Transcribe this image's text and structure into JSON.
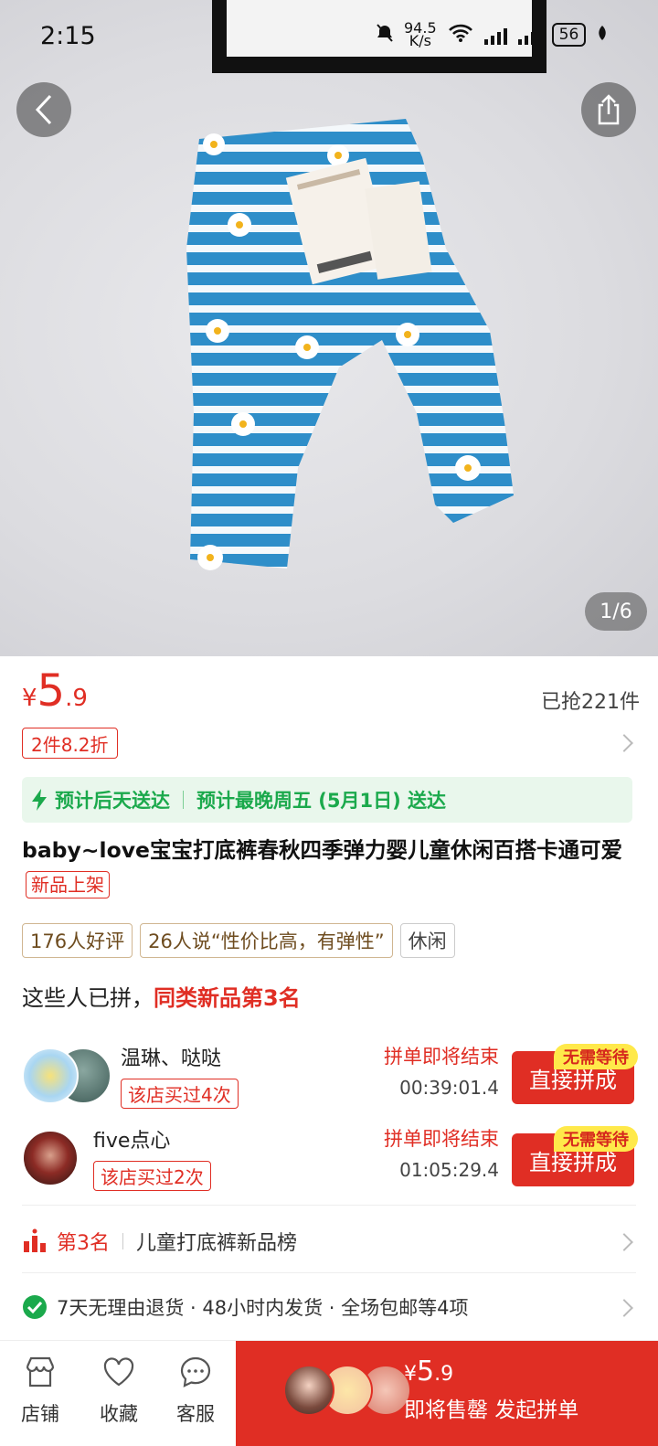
{
  "status_bar": {
    "time": "2:15",
    "net_speed_value": "94.5",
    "net_speed_unit": "K/s",
    "battery": "56"
  },
  "gallery": {
    "counter": "1/6"
  },
  "price": {
    "currency": "¥",
    "integer": "5",
    "decimal": ".9",
    "sold": "已抢221件"
  },
  "discount_tag": "2件8.2折",
  "delivery": {
    "primary": "预计后天送达",
    "secondary": "预计最晚周五 (5月1日) 送达"
  },
  "product": {
    "title": "baby~love宝宝打底裤春秋四季弹力婴儿童休闲百搭卡通可爱",
    "new_tag": "新品上架"
  },
  "review_tags": [
    "176人好评",
    "26人说“性价比高，有弹性”",
    "休闲"
  ],
  "group_header": {
    "prefix": "这些人已拼，",
    "highlight": "同类新品第3名"
  },
  "groups": [
    {
      "name": "温琳、哒哒",
      "badge": "该店买过4次",
      "status": "拼单即将结束",
      "countdown": "00:39:01.4",
      "button": "直接拼成",
      "button_tag": "无需等待"
    },
    {
      "name": "five点心",
      "badge": "该店买过2次",
      "status": "拼单即将结束",
      "countdown": "01:05:29.4",
      "button": "直接拼成",
      "button_tag": "无需等待"
    }
  ],
  "rank": {
    "label": "第3名",
    "list": "儿童打底裤新品榜"
  },
  "guarantee": "7天无理由退货 · 48小时内发货 · 全场包邮等4项",
  "bottom_bar": {
    "store": "店铺",
    "favorite": "收藏",
    "service": "客服",
    "buy_currency": "¥",
    "buy_integer": "5",
    "buy_decimal": ".9",
    "buy_label": "即将售罄 发起拼单"
  },
  "colors": {
    "accent": "#e02e24",
    "delivery_green": "#1ba94c",
    "tag_yellow": "#ffe94a"
  }
}
